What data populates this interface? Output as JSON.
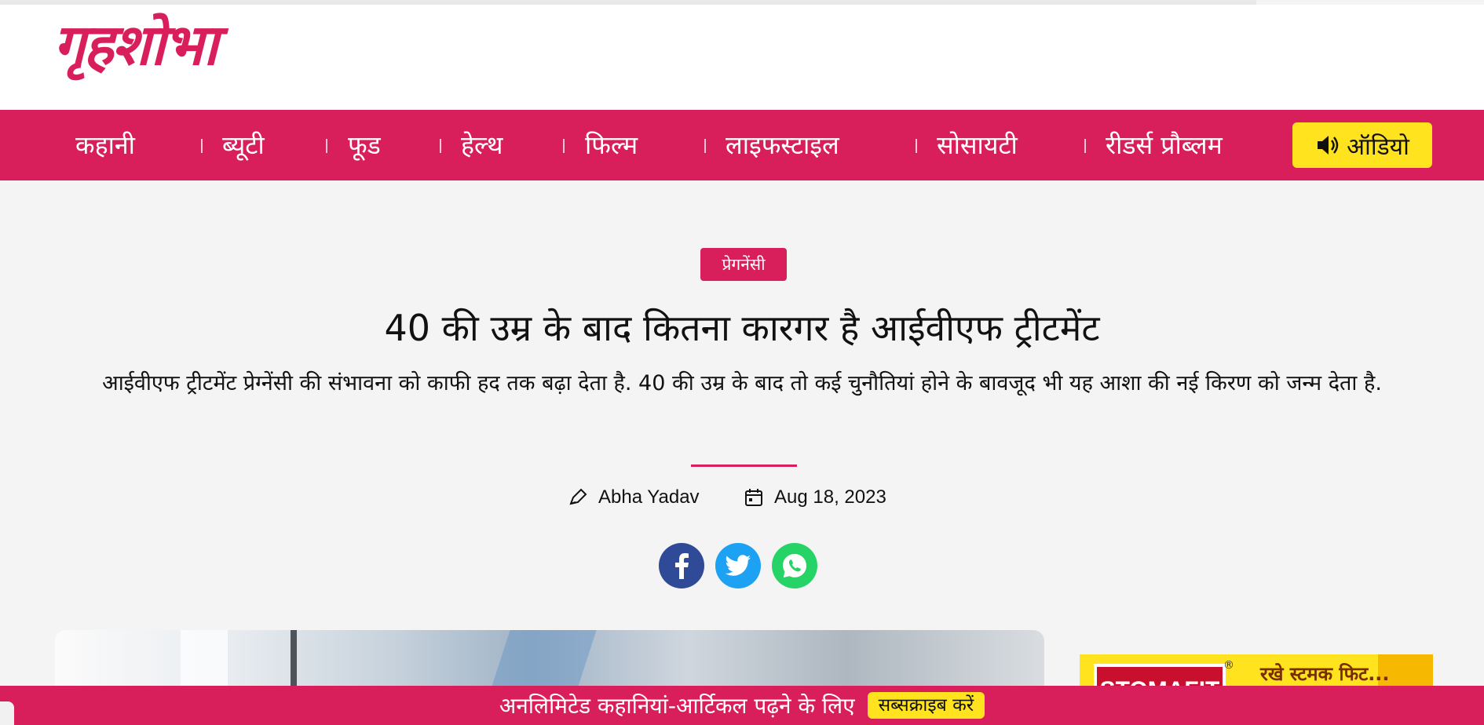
{
  "header": {
    "logo_text": "गृहशोभा"
  },
  "nav": {
    "items": [
      {
        "label": "कहानी"
      },
      {
        "label": "ब्यूटी"
      },
      {
        "label": "फूड"
      },
      {
        "label": "हेल्थ"
      },
      {
        "label": "फिल्म"
      },
      {
        "label": "लाइफस्टाइल"
      },
      {
        "label": "सोसायटी"
      },
      {
        "label": "रीडर्स प्रौब्लम"
      }
    ],
    "audio_label": "ऑडियो",
    "audio_icon": "speaker-icon"
  },
  "article": {
    "category": "प्रेगनेंसी",
    "title": "40 की उम्र के बाद कितना कारगर है आईवीएफ ट्रीटमेंट",
    "subtitle": "आईवीएफ ट्रीटमेंट प्रेग्नेंसी की संभावना को काफी हद तक बढ़ा देता है. 40 की उम्र के बाद तो कई चुनौतियां होने के बावजूद भी यह आशा की नई किरण को जन्म देता है.",
    "author": "Abha Yadav",
    "date": "Aug 18, 2023",
    "author_icon": "pen-icon",
    "date_icon": "calendar-icon"
  },
  "share": [
    {
      "name": "facebook",
      "icon": "facebook-icon",
      "color": "#3b5998"
    },
    {
      "name": "twitter",
      "icon": "twitter-icon",
      "color": "#1da1f2"
    },
    {
      "name": "whatsapp",
      "icon": "whatsapp-icon",
      "color": "#25d366"
    }
  ],
  "ad": {
    "brand": "STOMAFIT",
    "registered": "®",
    "tagline": "रखे स्टमक फिट..."
  },
  "bottom_bar": {
    "text": "अनलिमिटेड कहानियां-आर्टिकल पढ़ने के लिए",
    "button": "सब्सक्राइब करें"
  },
  "colors": {
    "brand": "#d81f5c",
    "accent_yellow": "#ffe31f",
    "background": "#f4f4f4"
  }
}
